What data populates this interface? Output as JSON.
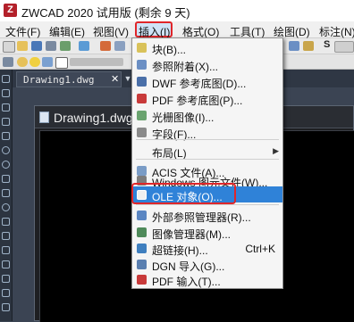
{
  "window": {
    "title": "ZWCAD 2020 试用版 (剩余 9 天)",
    "app_icon_letter": "Z"
  },
  "menubar": {
    "items": [
      {
        "label": "文件(F)"
      },
      {
        "label": "编辑(E)"
      },
      {
        "label": "视图(V)"
      },
      {
        "label": "插入(I)"
      },
      {
        "label": "格式(O)"
      },
      {
        "label": "工具(T)"
      },
      {
        "label": "绘图(D)"
      },
      {
        "label": "标注(N)"
      }
    ]
  },
  "toolbar": {
    "style_label": "S"
  },
  "document": {
    "tab_label": "Drawing1.dwg",
    "tab_close": "✕",
    "window_title": "Drawing1.dwg"
  },
  "insert_menu": {
    "items": [
      {
        "label": "块(B)...",
        "icon": "block-icon",
        "color": "#d9c25a"
      },
      {
        "label": "参照附着(X)...",
        "icon": "xref-attach-icon",
        "color": "#6b8fc4"
      },
      {
        "label": "DWF 参考底图(D)...",
        "icon": "dwf-icon",
        "color": "#4a6fa8"
      },
      {
        "label": "PDF 参考底图(P)...",
        "icon": "pdf-icon",
        "color": "#c83a3a"
      },
      {
        "label": "光栅图像(I)...",
        "icon": "raster-image-icon",
        "color": "#6aa36f"
      },
      {
        "label": "字段(F)...",
        "icon": "field-icon",
        "color": "#8a8a8a"
      },
      {
        "label": "布局(L)",
        "submenu": "▶"
      },
      {
        "label": "ACIS 文件(A)...",
        "icon": "acis-icon",
        "color": "#7a9cc6"
      },
      {
        "label": "Windows 图元文件(W)...",
        "icon": "wmf-icon",
        "color": "#7d7d7d"
      },
      {
        "label": "OLE 对象(O)...",
        "icon": "ole-icon",
        "color": "#f0f0f0"
      },
      {
        "label": "外部参照管理器(R)...",
        "icon": "xref-manager-icon",
        "color": "#5b86c2"
      },
      {
        "label": "图像管理器(M)...",
        "icon": "image-manager-icon",
        "color": "#4f8a5a"
      },
      {
        "label": "超链接(H)...",
        "shortcut": "Ctrl+K",
        "icon": "hyperlink-icon",
        "color": "#3f7fbf"
      },
      {
        "label": "DGN 导入(G)...",
        "icon": "dgn-icon",
        "color": "#5a7fb0"
      },
      {
        "label": "PDF 输入(T)...",
        "icon": "pdf-import-icon",
        "color": "#c83a3a"
      }
    ]
  },
  "colors": {
    "highlight": "#2f82d8",
    "annotation": "#e0262a"
  }
}
